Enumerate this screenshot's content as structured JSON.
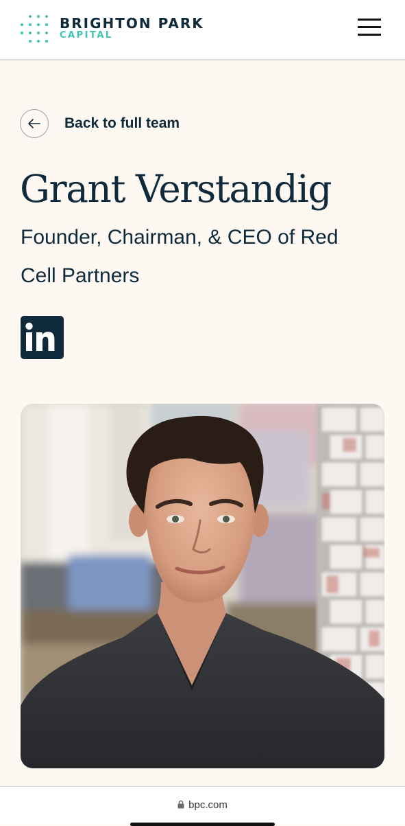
{
  "header": {
    "logo_line1": "BRIGHTON PARK",
    "logo_line2": "CAPITAL",
    "menu_icon": "hamburger-menu-icon"
  },
  "nav": {
    "back_label": "Back to full team",
    "back_icon": "arrow-left-icon"
  },
  "profile": {
    "name": "Grant Verstandig",
    "title": "Founder, Chairman, & CEO of Red Cell Partners",
    "social_icon": "linkedin-icon",
    "social_label": "in"
  },
  "browser": {
    "url": "bpc.com",
    "lock_icon": "lock-icon"
  },
  "colors": {
    "brand_navy": "#0f2a3a",
    "brand_teal": "#3fc3b0",
    "page_bg": "#fdf8f2"
  }
}
